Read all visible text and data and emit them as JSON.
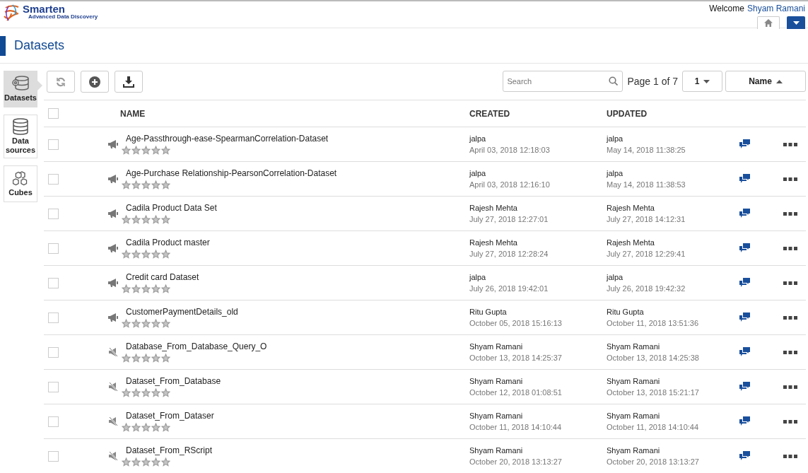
{
  "brand": {
    "name": "Smarten",
    "tagline": "Advanced Data Discovery"
  },
  "welcome": {
    "label": "Welcome",
    "user": "Shyam Ramani"
  },
  "page_title": "Datasets",
  "sidebar": [
    {
      "label": "Datasets",
      "kind": "datasets",
      "selected": true
    },
    {
      "label": "Data sources",
      "kind": "sources",
      "selected": false
    },
    {
      "label": "Cubes",
      "kind": "cubes",
      "selected": false
    }
  ],
  "search": {
    "placeholder": "Search"
  },
  "pager": {
    "label": "Page 1 of 7",
    "page": "1",
    "sort": "Name"
  },
  "select_all": {
    "checked": false
  },
  "columns": [
    "NAME",
    "CREATED",
    "UPDATED"
  ],
  "rows": [
    {
      "name": "Age-Passthrough-ease-SpearmanCorrelation-Dataset",
      "kind": "announce",
      "stars": 0,
      "created_by": "jalpa",
      "created_at": "April 03, 2018 12:18:03",
      "updated_by": "jalpa",
      "updated_at": "May 14, 2018 11:38:25",
      "checked": false
    },
    {
      "name": "Age-Purchase Relationship-PearsonCorrelation-Dataset",
      "kind": "announce",
      "stars": 0,
      "created_by": "jalpa",
      "created_at": "April 03, 2018 12:16:10",
      "updated_by": "jalpa",
      "updated_at": "May 14, 2018 11:38:53",
      "checked": false
    },
    {
      "name": "Cadila Product Data Set",
      "kind": "announce",
      "stars": 0,
      "created_by": "Rajesh Mehta",
      "created_at": "July 27, 2018 12:27:01",
      "updated_by": "Rajesh Mehta",
      "updated_at": "July 27, 2018 14:12:31",
      "checked": false
    },
    {
      "name": "Cadila Product master",
      "kind": "announce",
      "stars": 0,
      "created_by": "Rajesh Mehta",
      "created_at": "July 27, 2018 12:28:24",
      "updated_by": "Rajesh Mehta",
      "updated_at": "July 27, 2018 12:29:41",
      "checked": false
    },
    {
      "name": "Credit card Dataset",
      "kind": "announce",
      "stars": 0,
      "created_by": "jalpa",
      "created_at": "July 26, 2018 19:42:01",
      "updated_by": "jalpa",
      "updated_at": "July 26, 2018 19:42:32",
      "checked": false
    },
    {
      "name": "CustomerPaymentDetails_old",
      "kind": "announce",
      "stars": 0,
      "created_by": "Ritu Gupta",
      "created_at": "October 05, 2018 15:16:13",
      "updated_by": "Ritu Gupta",
      "updated_at": "October 11, 2018 13:51:36",
      "checked": false
    },
    {
      "name": "Database_From_Database_Query_O",
      "kind": "muted",
      "stars": 0,
      "created_by": "Shyam Ramani",
      "created_at": "October 13, 2018 14:25:37",
      "updated_by": "Shyam Ramani",
      "updated_at": "October 13, 2018 14:25:38",
      "checked": false
    },
    {
      "name": "Dataset_From_Database",
      "kind": "muted",
      "stars": 0,
      "created_by": "Shyam Ramani",
      "created_at": "October 12, 2018 01:08:51",
      "updated_by": "Shyam Ramani",
      "updated_at": "October 13, 2018 15:21:17",
      "checked": false
    },
    {
      "name": "Dataset_From_Dataser",
      "kind": "muted",
      "stars": 0,
      "created_by": "Shyam Ramani",
      "created_at": "October 11, 2018 14:10:44",
      "updated_by": "Shyam Ramani",
      "updated_at": "October 11, 2018 14:10:44",
      "checked": false
    },
    {
      "name": "Dataset_From_RScript",
      "kind": "muted",
      "stars": 0,
      "created_by": "Shyam Ramani",
      "created_at": "October 20, 2018 13:13:27",
      "updated_by": "Shyam Ramani",
      "updated_at": "October 20, 2018 13:13:27",
      "checked": false
    }
  ]
}
